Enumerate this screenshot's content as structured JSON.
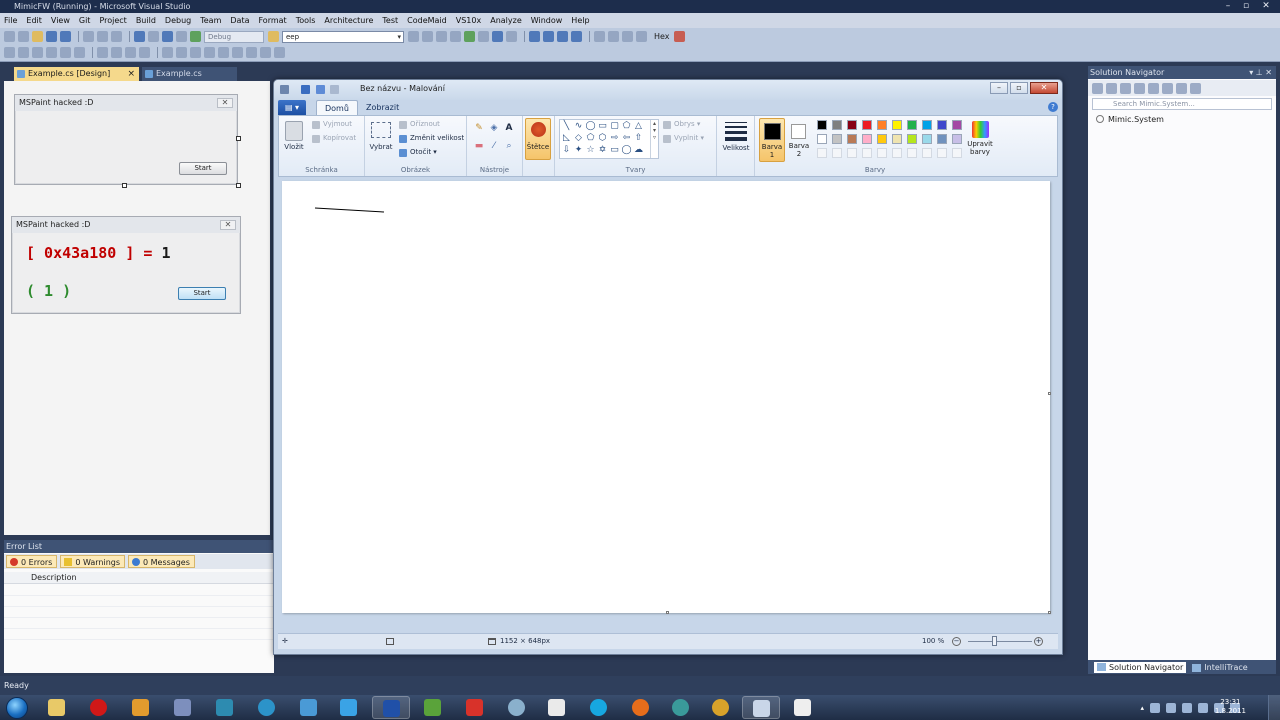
{
  "vs": {
    "title": "MimicFW (Running) - Microsoft Visual Studio",
    "menu": [
      "File",
      "Edit",
      "View",
      "Git",
      "Project",
      "Build",
      "Debug",
      "Team",
      "Data",
      "Format",
      "Tools",
      "Architecture",
      "Test",
      "CodeMaid",
      "VS10x",
      "Analyze",
      "Window",
      "Help"
    ],
    "toolbar": {
      "config": "Debug",
      "find": "eep",
      "hex": "Hex"
    },
    "tabs": {
      "design": "Example.cs [Design]",
      "design_close": "×",
      "code": "Example.cs"
    },
    "status": "Ready"
  },
  "designer": {
    "form1": {
      "title": "MSPaint hacked :D",
      "close": "✕",
      "button": "Start"
    },
    "form2": {
      "title": "MSPaint hacked :D",
      "close": "✕",
      "address": "[ 0x43a180 ] = ",
      "value": "1",
      "count": "( 1 )",
      "button": "Start"
    }
  },
  "error_list": {
    "title": "Error List",
    "errors": "0 Errors",
    "warnings": "0 Warnings",
    "messages": "0 Messages",
    "col_description": "Description"
  },
  "solution_navigator": {
    "title": "Solution Navigator",
    "search_placeholder": "Search Mimic.System...",
    "item": "Mimic.System",
    "tab1": "Solution Navigator",
    "tab2": "IntelliTrace"
  },
  "paint": {
    "title": "Bez názvu - Malování",
    "file_tab": "▤ ▾",
    "tab_home": "Domů",
    "tab_view": "Zobrazit",
    "clipboard": {
      "paste": "Vložit",
      "cut": "Vyjmout",
      "copy": "Kopírovat",
      "group": "Schránka"
    },
    "image": {
      "select": "Vybrat",
      "crop": "Oříznout",
      "resize": "Změnit velikost",
      "rotate": "Otočit",
      "group": "Obrázek"
    },
    "tools": {
      "group": "Nástroje"
    },
    "brushes": "Štětce",
    "shapes": {
      "outline": "Obrys",
      "fill": "Vyplnit",
      "group": "Tvary"
    },
    "size": "Velikost",
    "color1": "Barva 1",
    "color2": "Barva 2",
    "edit_colors": "Upravit barvy",
    "colors_group": "Barvy",
    "palette_row1": [
      "#000000",
      "#7f7f7f",
      "#880015",
      "#ed1c24",
      "#ff7f27",
      "#fff200",
      "#22b14c",
      "#00a2e8",
      "#3f48cc",
      "#a349a4"
    ],
    "palette_row2": [
      "#ffffff",
      "#c3c3c3",
      "#b97a57",
      "#ffaec9",
      "#ffc90e",
      "#efe4b0",
      "#b5e61d",
      "#99d9ea",
      "#7092be",
      "#c8bfe7"
    ],
    "canvas_size": "1152 × 648px",
    "zoom": "100 %"
  },
  "taskbar": {
    "time": "23:31",
    "date": "1.8.2011"
  }
}
